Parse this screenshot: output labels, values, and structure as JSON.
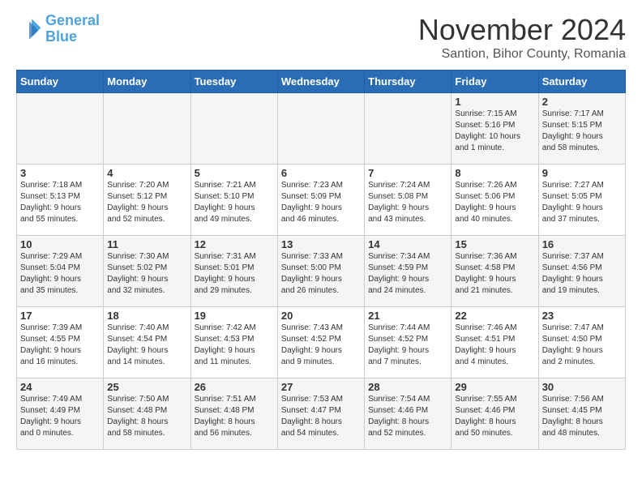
{
  "header": {
    "logo_line1": "General",
    "logo_line2": "Blue",
    "month": "November 2024",
    "location": "Santion, Bihor County, Romania"
  },
  "days_of_week": [
    "Sunday",
    "Monday",
    "Tuesday",
    "Wednesday",
    "Thursday",
    "Friday",
    "Saturday"
  ],
  "weeks": [
    [
      {
        "num": "",
        "info": ""
      },
      {
        "num": "",
        "info": ""
      },
      {
        "num": "",
        "info": ""
      },
      {
        "num": "",
        "info": ""
      },
      {
        "num": "",
        "info": ""
      },
      {
        "num": "1",
        "info": "Sunrise: 7:15 AM\nSunset: 5:16 PM\nDaylight: 10 hours\nand 1 minute."
      },
      {
        "num": "2",
        "info": "Sunrise: 7:17 AM\nSunset: 5:15 PM\nDaylight: 9 hours\nand 58 minutes."
      }
    ],
    [
      {
        "num": "3",
        "info": "Sunrise: 7:18 AM\nSunset: 5:13 PM\nDaylight: 9 hours\nand 55 minutes."
      },
      {
        "num": "4",
        "info": "Sunrise: 7:20 AM\nSunset: 5:12 PM\nDaylight: 9 hours\nand 52 minutes."
      },
      {
        "num": "5",
        "info": "Sunrise: 7:21 AM\nSunset: 5:10 PM\nDaylight: 9 hours\nand 49 minutes."
      },
      {
        "num": "6",
        "info": "Sunrise: 7:23 AM\nSunset: 5:09 PM\nDaylight: 9 hours\nand 46 minutes."
      },
      {
        "num": "7",
        "info": "Sunrise: 7:24 AM\nSunset: 5:08 PM\nDaylight: 9 hours\nand 43 minutes."
      },
      {
        "num": "8",
        "info": "Sunrise: 7:26 AM\nSunset: 5:06 PM\nDaylight: 9 hours\nand 40 minutes."
      },
      {
        "num": "9",
        "info": "Sunrise: 7:27 AM\nSunset: 5:05 PM\nDaylight: 9 hours\nand 37 minutes."
      }
    ],
    [
      {
        "num": "10",
        "info": "Sunrise: 7:29 AM\nSunset: 5:04 PM\nDaylight: 9 hours\nand 35 minutes."
      },
      {
        "num": "11",
        "info": "Sunrise: 7:30 AM\nSunset: 5:02 PM\nDaylight: 9 hours\nand 32 minutes."
      },
      {
        "num": "12",
        "info": "Sunrise: 7:31 AM\nSunset: 5:01 PM\nDaylight: 9 hours\nand 29 minutes."
      },
      {
        "num": "13",
        "info": "Sunrise: 7:33 AM\nSunset: 5:00 PM\nDaylight: 9 hours\nand 26 minutes."
      },
      {
        "num": "14",
        "info": "Sunrise: 7:34 AM\nSunset: 4:59 PM\nDaylight: 9 hours\nand 24 minutes."
      },
      {
        "num": "15",
        "info": "Sunrise: 7:36 AM\nSunset: 4:58 PM\nDaylight: 9 hours\nand 21 minutes."
      },
      {
        "num": "16",
        "info": "Sunrise: 7:37 AM\nSunset: 4:56 PM\nDaylight: 9 hours\nand 19 minutes."
      }
    ],
    [
      {
        "num": "17",
        "info": "Sunrise: 7:39 AM\nSunset: 4:55 PM\nDaylight: 9 hours\nand 16 minutes."
      },
      {
        "num": "18",
        "info": "Sunrise: 7:40 AM\nSunset: 4:54 PM\nDaylight: 9 hours\nand 14 minutes."
      },
      {
        "num": "19",
        "info": "Sunrise: 7:42 AM\nSunset: 4:53 PM\nDaylight: 9 hours\nand 11 minutes."
      },
      {
        "num": "20",
        "info": "Sunrise: 7:43 AM\nSunset: 4:52 PM\nDaylight: 9 hours\nand 9 minutes."
      },
      {
        "num": "21",
        "info": "Sunrise: 7:44 AM\nSunset: 4:52 PM\nDaylight: 9 hours\nand 7 minutes."
      },
      {
        "num": "22",
        "info": "Sunrise: 7:46 AM\nSunset: 4:51 PM\nDaylight: 9 hours\nand 4 minutes."
      },
      {
        "num": "23",
        "info": "Sunrise: 7:47 AM\nSunset: 4:50 PM\nDaylight: 9 hours\nand 2 minutes."
      }
    ],
    [
      {
        "num": "24",
        "info": "Sunrise: 7:49 AM\nSunset: 4:49 PM\nDaylight: 9 hours\nand 0 minutes."
      },
      {
        "num": "25",
        "info": "Sunrise: 7:50 AM\nSunset: 4:48 PM\nDaylight: 8 hours\nand 58 minutes."
      },
      {
        "num": "26",
        "info": "Sunrise: 7:51 AM\nSunset: 4:48 PM\nDaylight: 8 hours\nand 56 minutes."
      },
      {
        "num": "27",
        "info": "Sunrise: 7:53 AM\nSunset: 4:47 PM\nDaylight: 8 hours\nand 54 minutes."
      },
      {
        "num": "28",
        "info": "Sunrise: 7:54 AM\nSunset: 4:46 PM\nDaylight: 8 hours\nand 52 minutes."
      },
      {
        "num": "29",
        "info": "Sunrise: 7:55 AM\nSunset: 4:46 PM\nDaylight: 8 hours\nand 50 minutes."
      },
      {
        "num": "30",
        "info": "Sunrise: 7:56 AM\nSunset: 4:45 PM\nDaylight: 8 hours\nand 48 minutes."
      }
    ]
  ]
}
